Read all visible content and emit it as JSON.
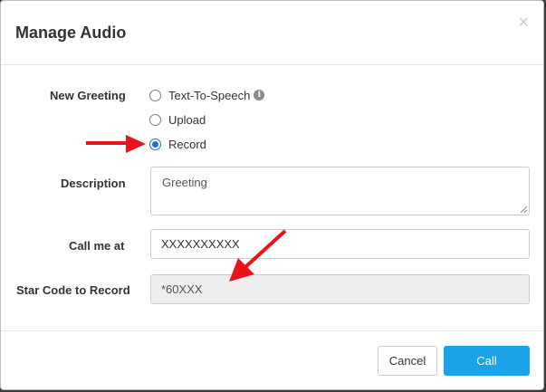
{
  "dialog": {
    "title": "Manage Audio",
    "close_glyph": "×"
  },
  "form": {
    "new_greeting_label": "New Greeting",
    "options": [
      {
        "label": "Text-To-Speech",
        "checked": false,
        "has_info_icon": true
      },
      {
        "label": "Upload",
        "checked": false
      },
      {
        "label": "Record",
        "checked": true
      }
    ],
    "info_icon_glyph": "i",
    "description_label": "Description",
    "description_value": "Greeting",
    "call_me_label": "Call me at",
    "call_me_value": "XXXXXXXXXX",
    "star_code_label": "Star Code to Record",
    "star_code_value": "*60XXX"
  },
  "footer": {
    "cancel_label": "Cancel",
    "call_label": "Call"
  },
  "colors": {
    "primary_button": "#1aa3e8",
    "radio_checked": "#1a6fe0",
    "annotation_arrow": "#e8141a"
  },
  "icons": [
    "close-icon",
    "info-icon",
    "annotation-arrow"
  ]
}
